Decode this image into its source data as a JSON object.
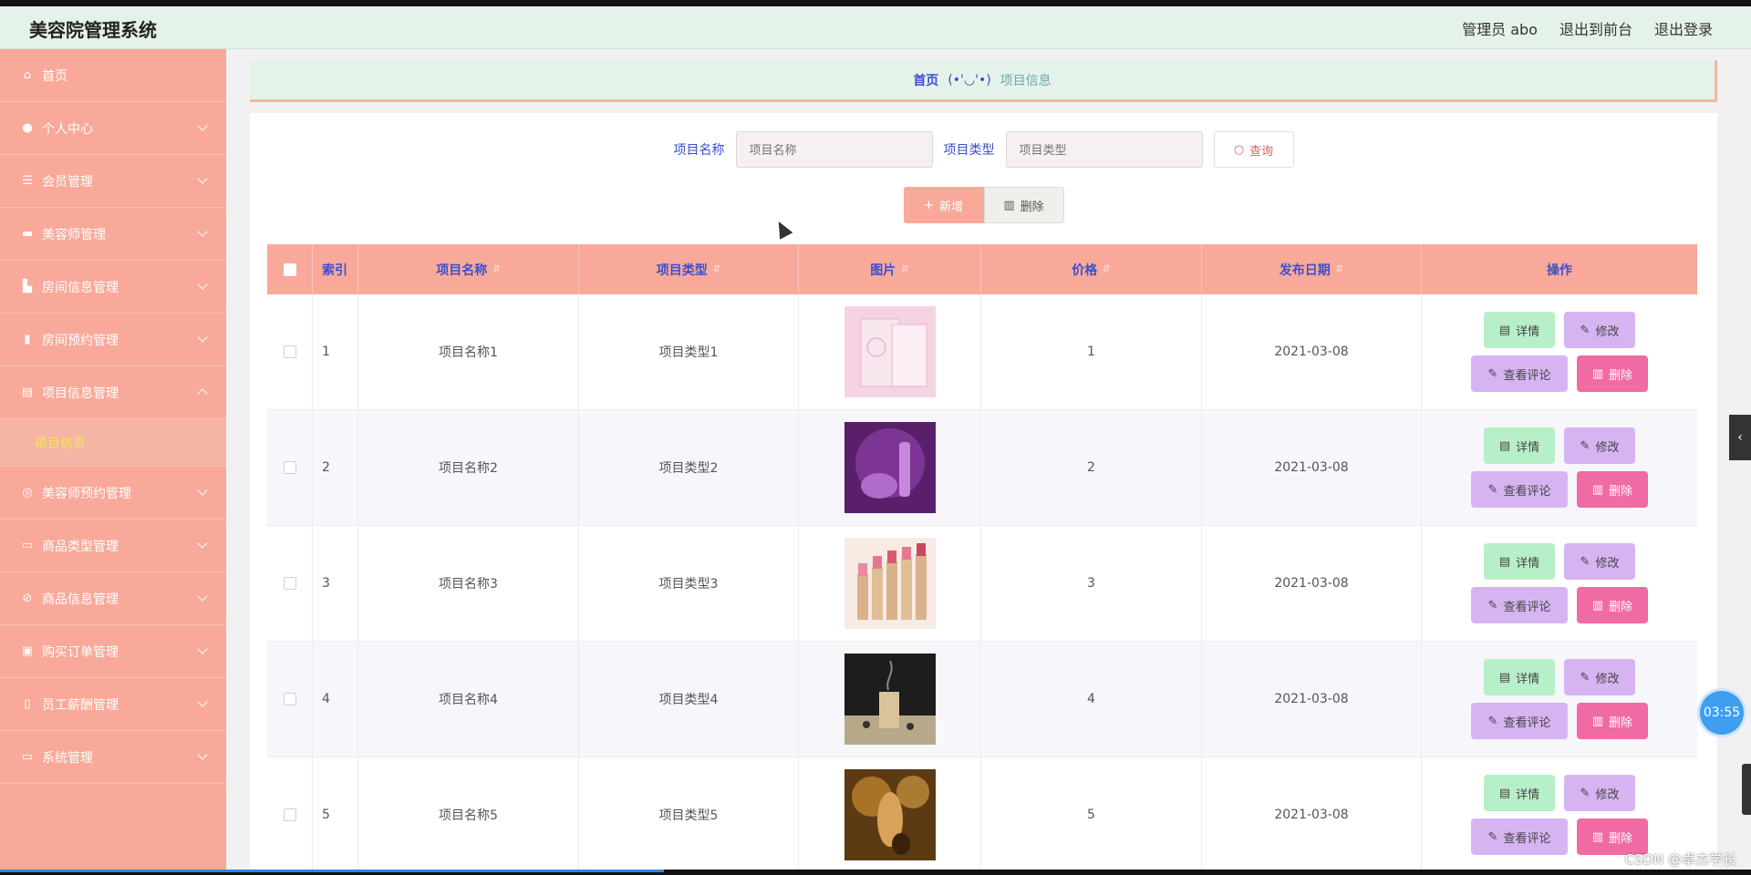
{
  "header": {
    "title": "美容院管理系统",
    "links": [
      "管理员 abo",
      "退出到前台",
      "退出登录"
    ]
  },
  "sidebar": {
    "items": [
      {
        "label": "首页",
        "icon": "home-icon"
      },
      {
        "label": "个人中心",
        "icon": "user-icon"
      },
      {
        "label": "会员管理",
        "icon": "list-icon"
      },
      {
        "label": "美容师管理",
        "icon": "briefcase-icon"
      },
      {
        "label": "房间信息管理",
        "icon": "room-icon"
      },
      {
        "label": "房间预约管理",
        "icon": "bar-chart-icon"
      },
      {
        "label": "项目信息管理",
        "icon": "clipboard-icon"
      },
      {
        "label": "美容师预约管理",
        "icon": "target-icon"
      },
      {
        "label": "商品类型管理",
        "icon": "monitor-icon"
      },
      {
        "label": "商品信息管理",
        "icon": "bell-off-icon"
      },
      {
        "label": "购买订单管理",
        "icon": "order-icon"
      },
      {
        "label": "员工薪酬管理",
        "icon": "microphone-icon"
      },
      {
        "label": "系统管理",
        "icon": "id-card-icon"
      }
    ],
    "active_sub": "项目信息"
  },
  "breadcrumb": {
    "home": "首页",
    "face": "(•'◡'•)",
    "current": "项目信息"
  },
  "search": {
    "name_label": "项目名称",
    "name_placeholder": "项目名称",
    "type_label": "项目类型",
    "type_placeholder": "项目类型",
    "query_label": "查询"
  },
  "actions": {
    "add_label": "新增",
    "delete_label": "删除"
  },
  "table": {
    "headers": {
      "index": "索引",
      "name": "项目名称",
      "type": "项目类型",
      "image": "图片",
      "price": "价格",
      "date": "发布日期",
      "ops": "操作"
    },
    "rows": [
      {
        "index": "1",
        "name": "项目名称1",
        "type": "项目类型1",
        "price": "1",
        "date": "2021-03-08"
      },
      {
        "index": "2",
        "name": "项目名称2",
        "type": "项目类型2",
        "price": "2",
        "date": "2021-03-08"
      },
      {
        "index": "3",
        "name": "项目名称3",
        "type": "项目类型3",
        "price": "3",
        "date": "2021-03-08"
      },
      {
        "index": "4",
        "name": "项目名称4",
        "type": "项目类型4",
        "price": "4",
        "date": "2021-03-08"
      },
      {
        "index": "5",
        "name": "项目名称5",
        "type": "项目类型5",
        "price": "5",
        "date": "2021-03-08"
      }
    ],
    "op_labels": {
      "detail": "详情",
      "edit": "修改",
      "review": "查看评论",
      "delete": "删除"
    }
  },
  "overlay": {
    "timer": "03:55",
    "watermark": "CSDN @卓杰学长"
  },
  "colors": {
    "sidebar": "#f9a99a",
    "header": "#e5f2ea",
    "accent_text": "#3a4fd0",
    "detail_btn": "#b7efc8",
    "edit_btn": "#d6b4f2",
    "delete_btn": "#f06aa3"
  }
}
